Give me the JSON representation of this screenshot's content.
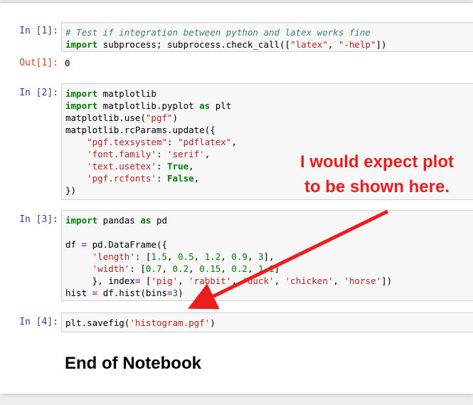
{
  "cells": [
    {
      "prompt": "In [1]:",
      "lines": [
        "# Test if integration between python and latex works fine",
        "import subprocess; subprocess.check_call([\"latex\", \"-help\"])"
      ],
      "output_prompt": "Out[1]:",
      "output": "0"
    },
    {
      "prompt": "In [2]:",
      "lines": [
        "import matplotlib",
        "import matplotlib.pyplot as plt",
        "matplotlib.use(\"pgf\")",
        "matplotlib.rcParams.update({",
        "    \"pgf.texsystem\": \"pdflatex\",",
        "    'font.family': 'serif',",
        "    'text.usetex': True,",
        "    'pgf.rcfonts': False,",
        "})"
      ]
    },
    {
      "prompt": "In [3]:",
      "lines": [
        "import pandas as pd",
        "",
        "df = pd.DataFrame({",
        "     'length': [1.5, 0.5, 1.2, 0.9, 3],",
        "     'width': [0.7, 0.2, 0.15, 0.2, 1.1]",
        "     }, index= ['pig', 'rabbit', 'duck', 'chicken', 'horse'])",
        "hist = df.hist(bins=3)"
      ]
    },
    {
      "prompt": "In [4]:",
      "lines": [
        "plt.savefig('histogram.pgf')"
      ]
    }
  ],
  "annotation": {
    "line1": "I would expect plot",
    "line2": "to be shown here.",
    "color": "#ee1c1c"
  },
  "end_title": "End of Notebook",
  "icons": {
    "arrow": "red-arrow-icon"
  }
}
